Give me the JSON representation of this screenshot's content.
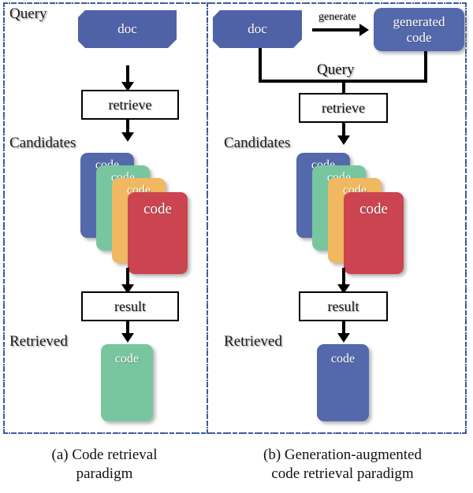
{
  "figure": {
    "colors": {
      "frame_blue": "#3a5ba0",
      "doc_blue": "#4f62a8",
      "card_blue": "#5468ac",
      "card_green": "#78c6a0",
      "card_orange": "#f0b860",
      "card_red": "#cc4450",
      "line_black": "#000000",
      "box_white": "#ffffff"
    },
    "panels": [
      {
        "id": "a",
        "caption_line1": "(a) Code retrieval",
        "caption_line2": "paradigm",
        "labels": {
          "query": "Query",
          "candidates": "Candidates",
          "retrieved": "Retrieved"
        },
        "doc": {
          "text": "doc"
        },
        "retrieve_box": {
          "text": "retrieve"
        },
        "result_box": {
          "text": "result"
        },
        "candidates": [
          {
            "text": "code",
            "color": "#5468ac"
          },
          {
            "text": "code",
            "color": "#78c6a0"
          },
          {
            "text": "code",
            "color": "#f0b860"
          },
          {
            "text": "code",
            "color": "#cc4450"
          }
        ],
        "retrieved_card": {
          "text": "code",
          "color": "#78c6a0"
        }
      },
      {
        "id": "b",
        "caption_line1": "(b) Generation-augmented",
        "caption_line2": "code retrieval paradigm",
        "labels": {
          "query": "Query",
          "candidates": "Candidates",
          "retrieved": "Retrieved"
        },
        "doc": {
          "text": "doc"
        },
        "generate_label": "generate",
        "generated_card": {
          "text": "generated\ncode",
          "line1": "generated",
          "line2": "code",
          "color": "#5468ac"
        },
        "retrieve_box": {
          "text": "retrieve"
        },
        "result_box": {
          "text": "result"
        },
        "candidates": [
          {
            "text": "code",
            "color": "#5468ac"
          },
          {
            "text": "code",
            "color": "#78c6a0"
          },
          {
            "text": "code",
            "color": "#f0b860"
          },
          {
            "text": "code",
            "color": "#cc4450"
          }
        ],
        "retrieved_card": {
          "text": "code",
          "color": "#5468ac"
        }
      }
    ]
  }
}
